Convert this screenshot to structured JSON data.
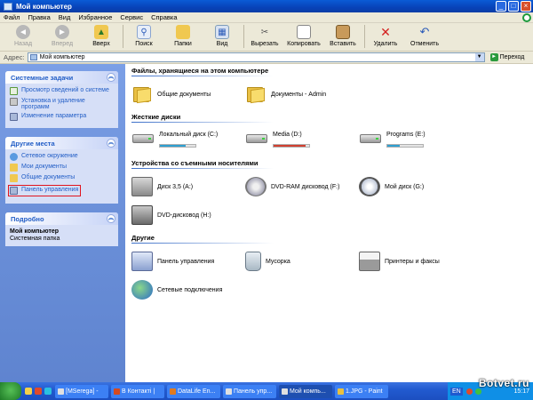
{
  "window": {
    "title": "Мой компьютер"
  },
  "menu": [
    "Файл",
    "Правка",
    "Вид",
    "Избранное",
    "Сервис",
    "Справка"
  ],
  "toolbar": {
    "back": "Назад",
    "forward": "Вперед",
    "up": "Вверх",
    "search": "Поиск",
    "folders": "Папки",
    "view": "Вид",
    "cut": "Вырезать",
    "copy": "Копировать",
    "paste": "Вставить",
    "delete": "Удалить",
    "undo": "Отменить"
  },
  "address": {
    "label": "Адрес:",
    "value": "Мой компьютер",
    "go": "Переход"
  },
  "sidebar": {
    "system_tasks": {
      "title": "Системные задачи",
      "items": [
        "Просмотр сведений о системе",
        "Установка и удаление программ",
        "Изменение параметра"
      ]
    },
    "other_places": {
      "title": "Другие места",
      "items": [
        "Сетевое окружение",
        "Мои документы",
        "Общие документы",
        "Панель управления"
      ]
    },
    "details": {
      "title": "Подробно",
      "name": "Мой компьютер",
      "type": "Системная папка"
    }
  },
  "main": {
    "groups": [
      {
        "title": "Файлы, хранящиеся на этом компьютере",
        "items": [
          "Общие документы",
          "Документы - Admin"
        ]
      },
      {
        "title": "Жесткие диски",
        "items": [
          {
            "label": "Локальный диск (C:)",
            "usage": 0.72
          },
          {
            "label": "Media (D:)",
            "usage": 0.9
          },
          {
            "label": "Programs (E:)",
            "usage": 0.35
          }
        ]
      },
      {
        "title": "Устройства со съемными носителями",
        "items": [
          "Диск 3,5 (A:)",
          "DVD-RAM дисковод (F:)",
          "Мой диск (G:)",
          "DVD-дисковод (H:)"
        ]
      },
      {
        "title": "Другие",
        "items": [
          "Панель управления",
          "Мусорка",
          "Принтеры и факсы",
          "Сетевые подключения"
        ]
      }
    ]
  },
  "taskbar": {
    "tasks": [
      "[MSerega] -",
      "В Контакті |",
      "DataLife En...",
      "Панель упр...",
      "Мой компь...",
      "1.JPG - Paint"
    ],
    "lang": "EN",
    "clock": "15:17"
  },
  "watermark": "Botvet.ru",
  "colors": {
    "title_blue": "#0842b8",
    "link_blue": "#215dc6",
    "sidebar_bg": "#6a8fd8",
    "highlight_red": "#e0141e"
  }
}
